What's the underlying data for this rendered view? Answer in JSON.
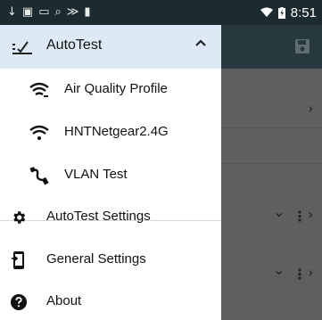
{
  "status_bar": {
    "left_icons": [
      "download-arrow-icon",
      "vibrate-icon",
      "cast-icon",
      "search-100-icon",
      "wifi-scan-icon",
      "sd-card-icon"
    ],
    "right_icons": [
      "wifi-icon",
      "battery-icon"
    ],
    "time": "8:51"
  },
  "drawer": {
    "header": {
      "title": "AutoTest",
      "icon": "checklist-icon",
      "expand_icon": "chevron-up-icon"
    },
    "sub_items": [
      {
        "label": "Air Quality Profile",
        "icon": "wifi-air-quality-icon"
      },
      {
        "label": "HNTNetgear2.4G",
        "icon": "wifi-icon"
      },
      {
        "label": "VLAN Test",
        "icon": "cable-icon"
      }
    ],
    "items": [
      {
        "label": "AutoTest Settings",
        "icon": "gear-icon"
      },
      {
        "label": "General Settings",
        "icon": "device-settings-icon"
      },
      {
        "label": "About",
        "icon": "help-circle-icon"
      }
    ]
  },
  "background": {
    "toolbar_icon": "save-icon",
    "row_icons": [
      "chevron-right-icon",
      "chevron-down-icon",
      "more-vert-icon"
    ]
  },
  "colors": {
    "status_bar": "#1c2b30",
    "header_highlight": "#ddeaf5",
    "scrim": "#5f5f5f",
    "toolbar": "#27393e"
  }
}
